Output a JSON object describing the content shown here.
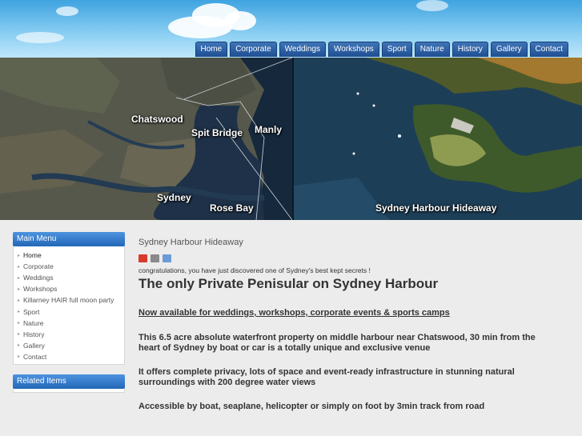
{
  "nav": [
    "Home",
    "Corporate",
    "Weddings",
    "Workshops",
    "Sport",
    "Nature",
    "History",
    "Gallery",
    "Contact"
  ],
  "banner": {
    "map_labels": [
      "Chatswood",
      "Spit Bridge",
      "Manly",
      "Sydney",
      "Rose Bay"
    ],
    "photo_label": "Sydney Harbour Hideaway"
  },
  "sidebar": {
    "main_menu_title": "Main Menu",
    "items": [
      "Home",
      "Corporate",
      "Weddings",
      "Workshops",
      "Killarney HAIR full moon party",
      "Sport",
      "Nature",
      "History",
      "Gallery",
      "Contact"
    ],
    "related_title": "Related Items"
  },
  "article": {
    "title": "Sydney Harbour Hideaway",
    "icons": [
      "pdf-icon",
      "print-icon",
      "email-icon"
    ],
    "intro": "congratulations, you have just discovered one of Sydney's best kept secrets !",
    "headline": "The only Private Penisular on Sydney Harbour",
    "p1": "Now available for weddings, workshops, corporate events & sports camps",
    "p2": "This 6.5 acre absolute waterfront property on middle harbour near Chatswood, 30 min from the heart of Sydney by boat or car is a totally unique and exclusive venue",
    "p3": "It offers complete privacy, lots of space and event-ready infrastructure in stunning natural surroundings with 200 degree water views",
    "p4": "Accessible by boat, seaplane, helicopter or simply on foot by 3min track from road"
  },
  "colors": {
    "nav": "#1e4f92",
    "module": "#2f7bd0",
    "text": "#333333"
  }
}
